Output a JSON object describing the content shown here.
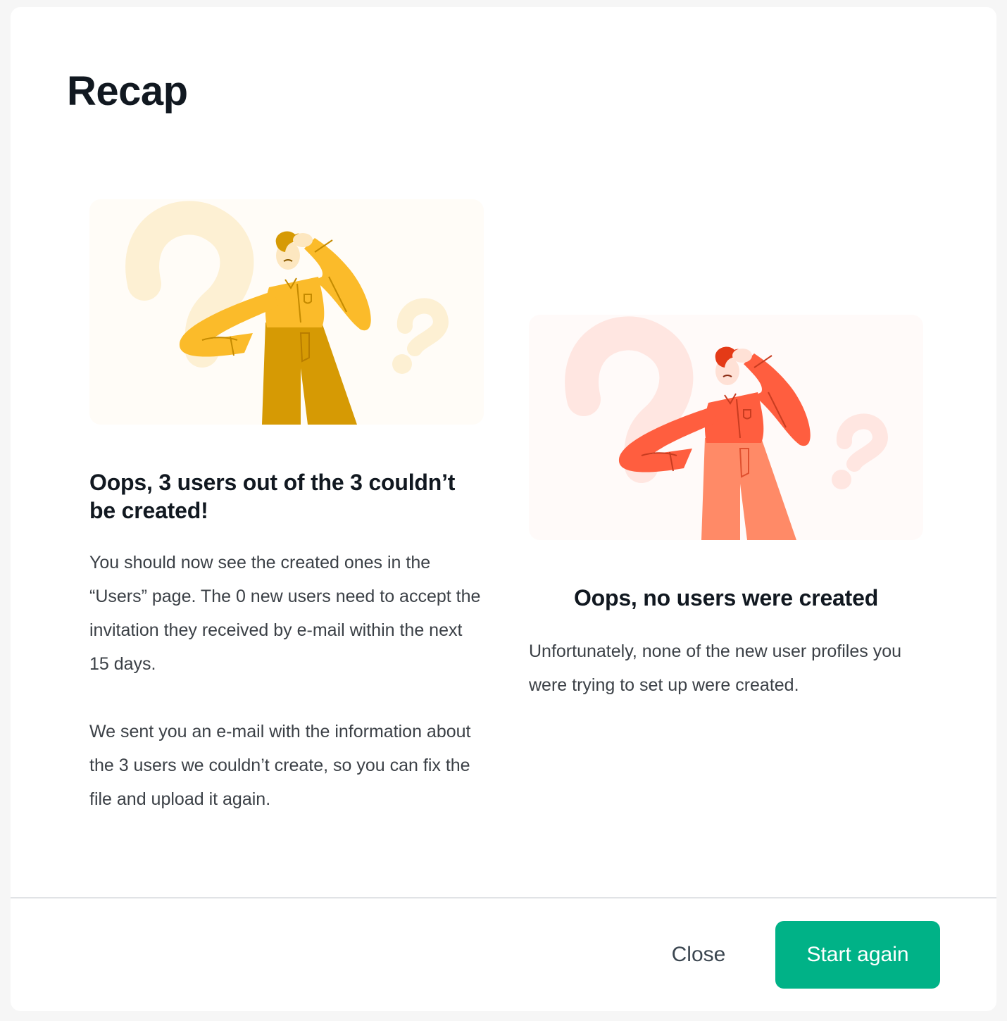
{
  "dialog": {
    "title": "Recap"
  },
  "colors": {
    "primary_button": "#00b287",
    "left_figure_shirt": "#fbbb2a",
    "left_figure_pants": "#d69a04",
    "right_figure_shirt": "#ff5e3f",
    "right_figure_pants": "#ff8a67"
  },
  "cards": [
    {
      "illustration": "confused-person-yellow-illustration",
      "heading": "Oops, 3 users out of the 3 couldn’t be created!",
      "paragraphs": [
        "You should now see the created ones in the “Users” page. The 0 new users need to accept the invitation they received by e-mail within the next 15 days.",
        "We sent you an e-mail with the information about the 3 users we couldn’t create, so you can fix the file and upload it again."
      ]
    },
    {
      "illustration": "confused-person-red-illustration",
      "heading": "Oops, no users were created",
      "paragraphs": [
        "Unfortunately, none of the new user profiles you were trying to set up were created."
      ]
    }
  ],
  "footer": {
    "close_label": "Close",
    "primary_label": "Start again"
  }
}
